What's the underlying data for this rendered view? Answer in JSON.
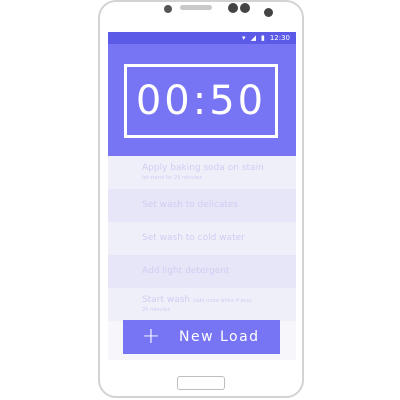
{
  "status_bar": {
    "time": "12:30",
    "wifi_icon": "wifi-icon",
    "signal_icon": "signal-icon",
    "battery_icon": "battery-icon"
  },
  "timer": {
    "value": "00:50"
  },
  "tasks": [
    {
      "title": "Apply baking soda on stain",
      "subtitle": "let stand for 25 minutes"
    },
    {
      "title": "Set wash to delicates",
      "subtitle": ""
    },
    {
      "title": "Set wash to cold water",
      "subtitle": ""
    },
    {
      "title": "Add light detergent",
      "subtitle": ""
    },
    {
      "title": "Start wash",
      "note": "(add more white if any)",
      "subtitle": "25 minutes"
    }
  ],
  "new_load": {
    "icon": "plus-icon",
    "label": "New Load"
  },
  "colors": {
    "primary": "#7775f4",
    "status_bar": "#5c5be8",
    "text_faded": "#cfcdf2"
  }
}
